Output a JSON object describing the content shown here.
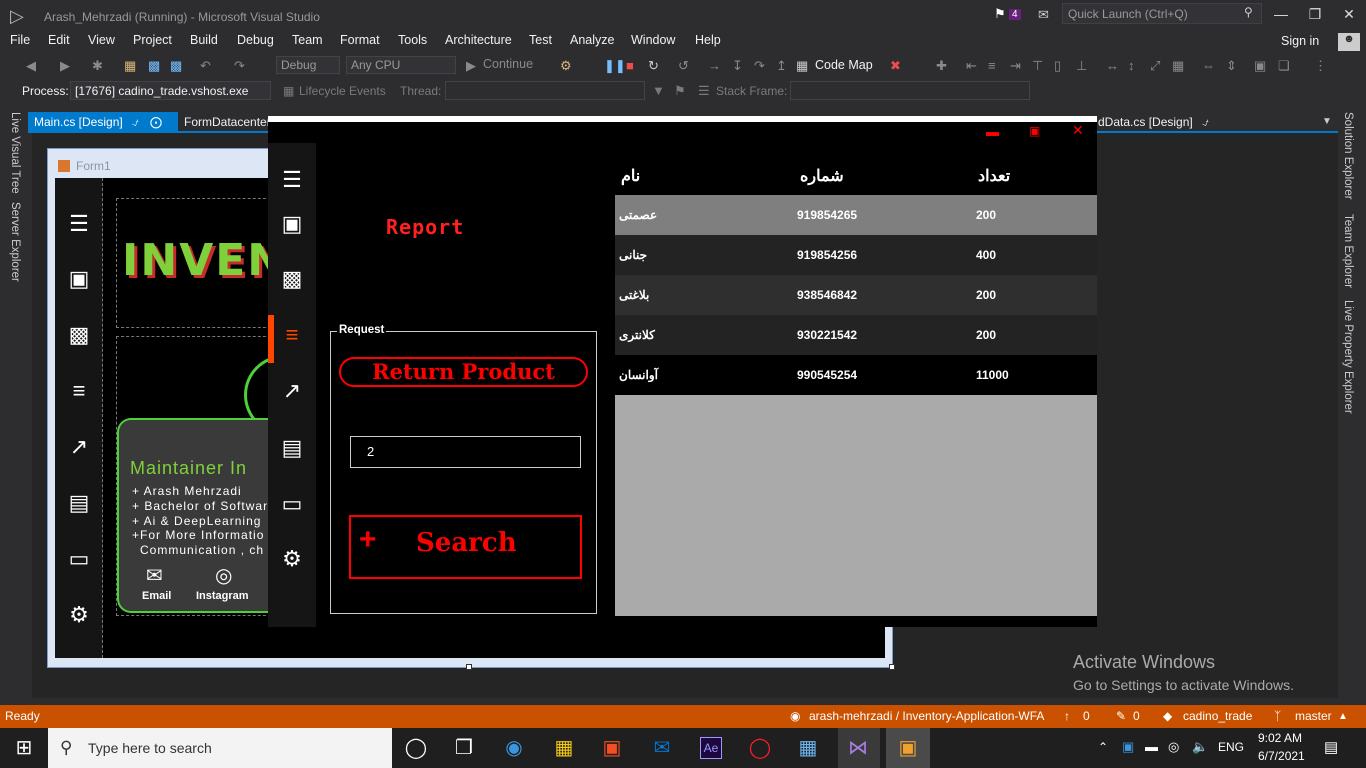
{
  "window": {
    "title": "Arash_Mehrzadi (Running) - Microsoft Visual Studio",
    "notification_count": "4",
    "quick_launch_placeholder": "Quick Launch (Ctrl+Q)",
    "sign_in": "Sign in"
  },
  "menu": [
    "File",
    "Edit",
    "View",
    "Project",
    "Build",
    "Debug",
    "Team",
    "Format",
    "Tools",
    "Architecture",
    "Test",
    "Analyze",
    "Window",
    "Help"
  ],
  "toolbar": {
    "config": "Debug",
    "platform": "Any CPU",
    "continue_label": "Continue",
    "code_map": "Code Map",
    "process_label": "Process:",
    "process_value": "[17676] cadino_trade.vshost.exe",
    "lifecycle": "Lifecycle Events",
    "thread": "Thread:",
    "stack_frame": "Stack Frame:"
  },
  "tabs": {
    "main": "Main.cs [Design]",
    "form": "FormDatacenter",
    "data": "dData.cs [Design]"
  },
  "side_tabs": {
    "left": [
      "Live Visual Tree",
      "Server Explorer"
    ],
    "right": [
      "Solution Explorer",
      "Team Explorer",
      "Live Property Explorer"
    ]
  },
  "designer": {
    "form_title": "Form1",
    "brand_text": "INVEN",
    "maintainer_title": "Maintainer In",
    "maintainer_lines": [
      "+ Arash Mehrzadi",
      "+ Bachelor of Softwar",
      "+ Ai & DeepLearning",
      "+For More Informatio",
      "Communication , ch"
    ],
    "email_label": "Email",
    "instagram_label": "Instagram"
  },
  "running_form": {
    "report_title": "Report",
    "request_group": "Request",
    "return_button": "Return Product",
    "quantity_value": "2",
    "search_button": "Search",
    "grid": {
      "columns": [
        "نام",
        "شماره",
        "تعداد"
      ],
      "rows": [
        {
          "name": "عصمتی",
          "number": "919854265",
          "count": "200"
        },
        {
          "name": "جنانی",
          "number": "919854256",
          "count": "400"
        },
        {
          "name": "بلاغتی",
          "number": "938546842",
          "count": "200"
        },
        {
          "name": "کلانتری",
          "number": "930221542",
          "count": "200"
        },
        {
          "name": "آوانسان",
          "number": "990545254",
          "count": "11000"
        }
      ],
      "row_colors": [
        "#7f7f7f",
        "#232323",
        "#2f2f2f",
        "#232323",
        "#000000"
      ]
    }
  },
  "watermark": {
    "line1": "Activate Windows",
    "line2": "Go to Settings to activate Windows."
  },
  "statusbar": {
    "state": "Ready",
    "repo": "arash-mehrzadi / Inventory-Application-WFA",
    "up_count": "0",
    "edit_count": "0",
    "project": "cadino_trade",
    "branch": "master"
  },
  "taskbar": {
    "search_placeholder": "Type here to search",
    "language": "ENG",
    "time": "9:02 AM",
    "date": "6/7/2021"
  },
  "colors": {
    "accent": "#007acc",
    "status": "#ca5100",
    "danger": "#ff0000",
    "selected_marker": "#ff4500"
  }
}
